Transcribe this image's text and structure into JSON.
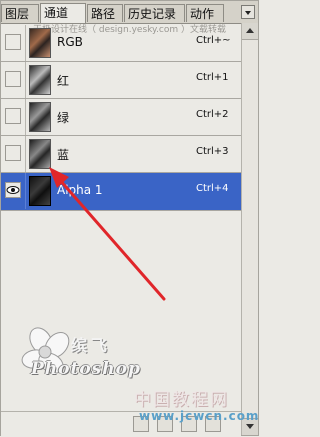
{
  "tabs": [
    {
      "label": "图层",
      "active": false
    },
    {
      "label": "通道",
      "active": true
    },
    {
      "label": "路径",
      "active": false
    },
    {
      "label": "历史记录",
      "active": false
    },
    {
      "label": "动作",
      "active": false
    }
  ],
  "watermark_text": "天极设计在线（ design.yesky.com ）文载转载",
  "channels": [
    {
      "name": "RGB",
      "shortcut": "Ctrl+~",
      "visible": false,
      "selected": false
    },
    {
      "name": "红",
      "shortcut": "Ctrl+1",
      "visible": false,
      "selected": false
    },
    {
      "name": "绿",
      "shortcut": "Ctrl+2",
      "visible": false,
      "selected": false
    },
    {
      "name": "蓝",
      "shortcut": "Ctrl+3",
      "visible": false,
      "selected": false
    },
    {
      "name": "Alpha 1",
      "shortcut": "Ctrl+4",
      "visible": true,
      "selected": true
    }
  ],
  "overlay": {
    "logo_text": "缤飞",
    "brand": "Photoshop",
    "site_name": "中国教程网",
    "site_url": "www.jcwcn.com"
  },
  "colors": {
    "selection": "#3a64c6",
    "arrow": "#e0262a"
  }
}
